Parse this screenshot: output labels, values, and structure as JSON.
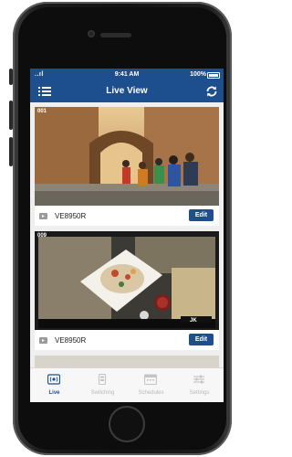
{
  "status_bar": {
    "signal": "..ıl",
    "time": "9:41 AM",
    "battery": "100%"
  },
  "header": {
    "title": "Live View"
  },
  "cameras": [
    {
      "number": "001",
      "name": "VE8950R",
      "edit_label": "Edit"
    },
    {
      "number": "009",
      "name": "VE8950R",
      "edit_label": "Edit"
    }
  ],
  "tabs": [
    {
      "label": "Live",
      "icon": "live-icon",
      "active": true
    },
    {
      "label": "Switching",
      "icon": "switching-icon",
      "active": false
    },
    {
      "label": "Schedules",
      "icon": "schedules-icon",
      "active": false
    },
    {
      "label": "Settings",
      "icon": "settings-icon",
      "active": false
    }
  ],
  "colors": {
    "accent": "#1d4f8f",
    "tab_inactive": "#b9b9b9",
    "background": "#f2f2f2"
  }
}
